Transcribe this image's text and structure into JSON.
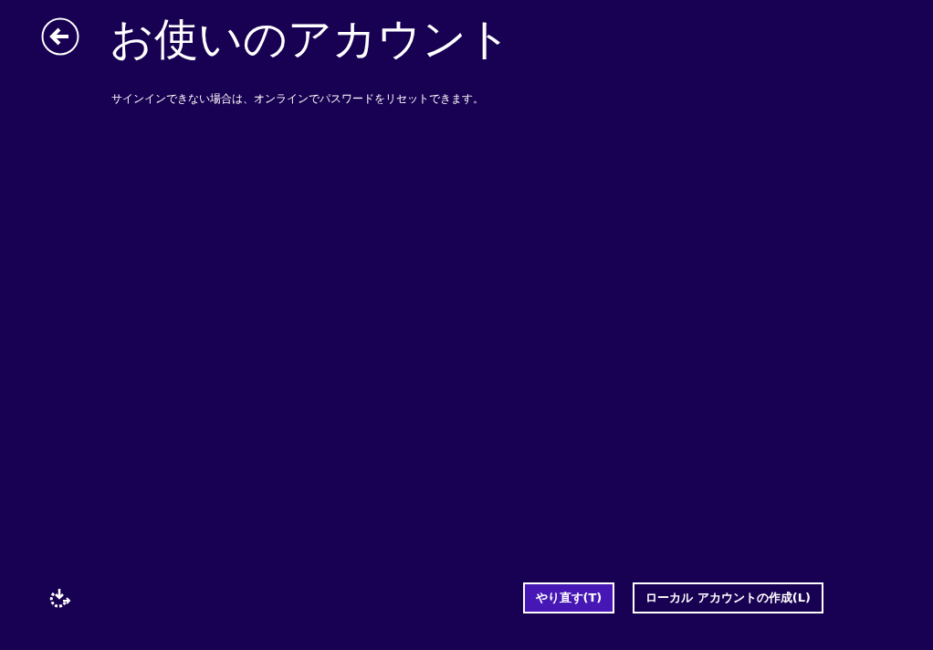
{
  "title": "お使いのアカウント",
  "message": "サインインできない場合は、オンラインでパスワードをリセットできます。",
  "buttons": [
    {
      "label": "やり直す(T)",
      "kind": "primary"
    },
    {
      "label": "ローカル アカウントの作成(L)",
      "kind": "secondary"
    }
  ]
}
